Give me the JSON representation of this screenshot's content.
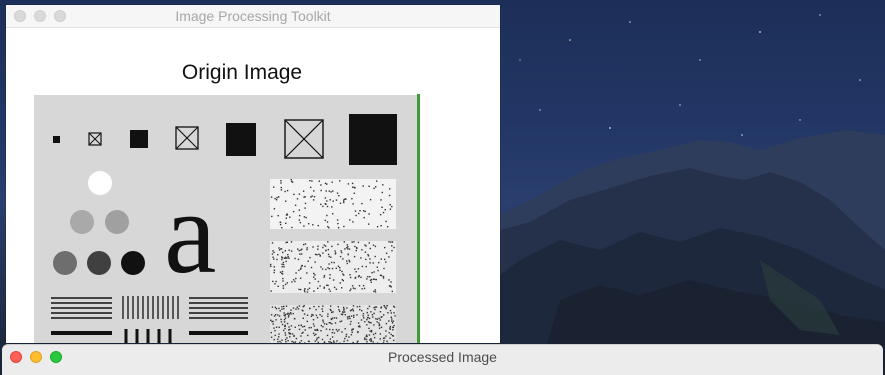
{
  "origin_window": {
    "title": "Image Processing Toolkit",
    "heading": "Origin Image",
    "test_pattern": {
      "glyph": "a"
    }
  },
  "processed_window": {
    "title": "Processed Image"
  },
  "colors": {
    "accent_green_bar": "#3f9a38",
    "traffic_red": "#fe5f57",
    "traffic_yellow": "#febc2e",
    "traffic_green": "#28c840"
  }
}
